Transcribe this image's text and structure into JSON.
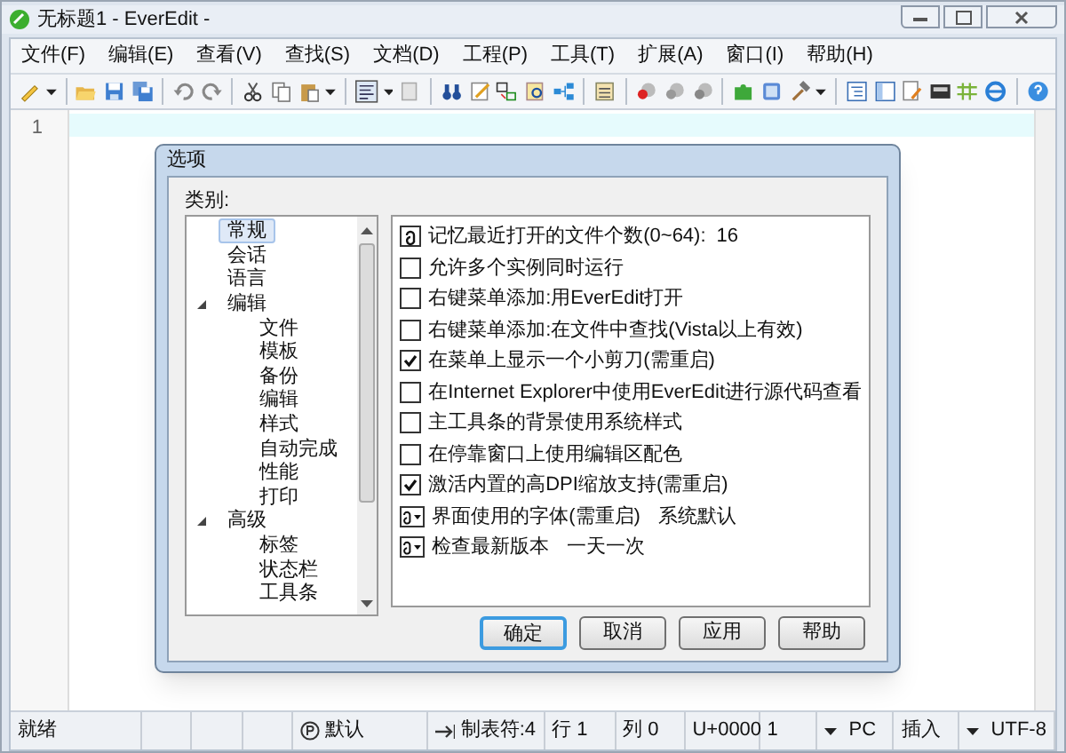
{
  "window": {
    "title": "无标题1 - EverEdit -"
  },
  "menu": [
    "文件(F)",
    "编辑(E)",
    "查看(V)",
    "查找(S)",
    "文档(D)",
    "工程(P)",
    "工具(T)",
    "扩展(A)",
    "窗口(I)",
    "帮助(H)"
  ],
  "editor": {
    "line_numbers": [
      "1"
    ]
  },
  "dialog": {
    "title": "选项",
    "category_label": "类别:",
    "categories": [
      {
        "label": "常规",
        "selected": true
      },
      {
        "label": "会话",
        "selected": false
      },
      {
        "label": "语言",
        "selected": false
      },
      {
        "label": "编辑",
        "selected": false,
        "expanded": true,
        "children": [
          {
            "label": "文件",
            "selected": false
          },
          {
            "label": "模板",
            "selected": false
          },
          {
            "label": "备份",
            "selected": false
          },
          {
            "label": "编辑",
            "selected": false
          },
          {
            "label": "样式",
            "selected": false
          },
          {
            "label": "自动完成",
            "selected": false
          },
          {
            "label": "性能",
            "selected": false
          },
          {
            "label": "打印",
            "selected": false
          }
        ]
      },
      {
        "label": "高级",
        "selected": false,
        "expanded": true,
        "children": [
          {
            "label": "标签",
            "selected": false
          },
          {
            "label": "状态栏",
            "selected": false
          },
          {
            "label": "工具条",
            "selected": false
          }
        ]
      }
    ],
    "options": [
      {
        "kind": "value",
        "label": "记忆最近打开的文件个数(0~64):",
        "value": "16"
      },
      {
        "kind": "checkbox",
        "label": "允许多个实例同时运行",
        "checked": false
      },
      {
        "kind": "checkbox",
        "label": "右键菜单添加:用EverEdit打开",
        "checked": false
      },
      {
        "kind": "checkbox",
        "label": "右键菜单添加:在文件中查找(Vista以上有效)",
        "checked": false
      },
      {
        "kind": "checkbox",
        "label": "在菜单上显示一个小剪刀(需重启)",
        "checked": true
      },
      {
        "kind": "checkbox",
        "label": "在Internet Explorer中使用EverEdit进行源代码查看",
        "checked": false
      },
      {
        "kind": "checkbox",
        "label": "主工具条的背景使用系统样式",
        "checked": false
      },
      {
        "kind": "checkbox",
        "label": "在停靠窗口上使用编辑区配色",
        "checked": false
      },
      {
        "kind": "checkbox",
        "label": "激活内置的高DPI缩放支持(需重启)",
        "checked": true
      },
      {
        "kind": "dropdown",
        "label": "界面使用的字体(需重启)",
        "value": "系统默认"
      },
      {
        "kind": "dropdown",
        "label": "检查最新版本",
        "value": "一天一次"
      }
    ],
    "buttons": [
      {
        "label": "确定",
        "default": true
      },
      {
        "label": "取消",
        "default": false
      },
      {
        "label": "应用",
        "default": false
      },
      {
        "label": "帮助",
        "default": false
      }
    ]
  },
  "status_bar": {
    "cells": [
      {
        "kind": "plain",
        "text": "就绪"
      },
      {
        "kind": "mode",
        "text": "默认"
      },
      {
        "kind": "tab",
        "text": "制表符:4"
      },
      {
        "kind": "plain",
        "text": "行 1"
      },
      {
        "kind": "plain",
        "text": "列 0"
      },
      {
        "kind": "plain",
        "text": "U+0000"
      },
      {
        "kind": "plain",
        "text": "1"
      },
      {
        "kind": "dropdown",
        "text": "PC"
      },
      {
        "kind": "plain",
        "text": "插入"
      },
      {
        "kind": "dropdown",
        "text": "UTF-8"
      }
    ]
  }
}
